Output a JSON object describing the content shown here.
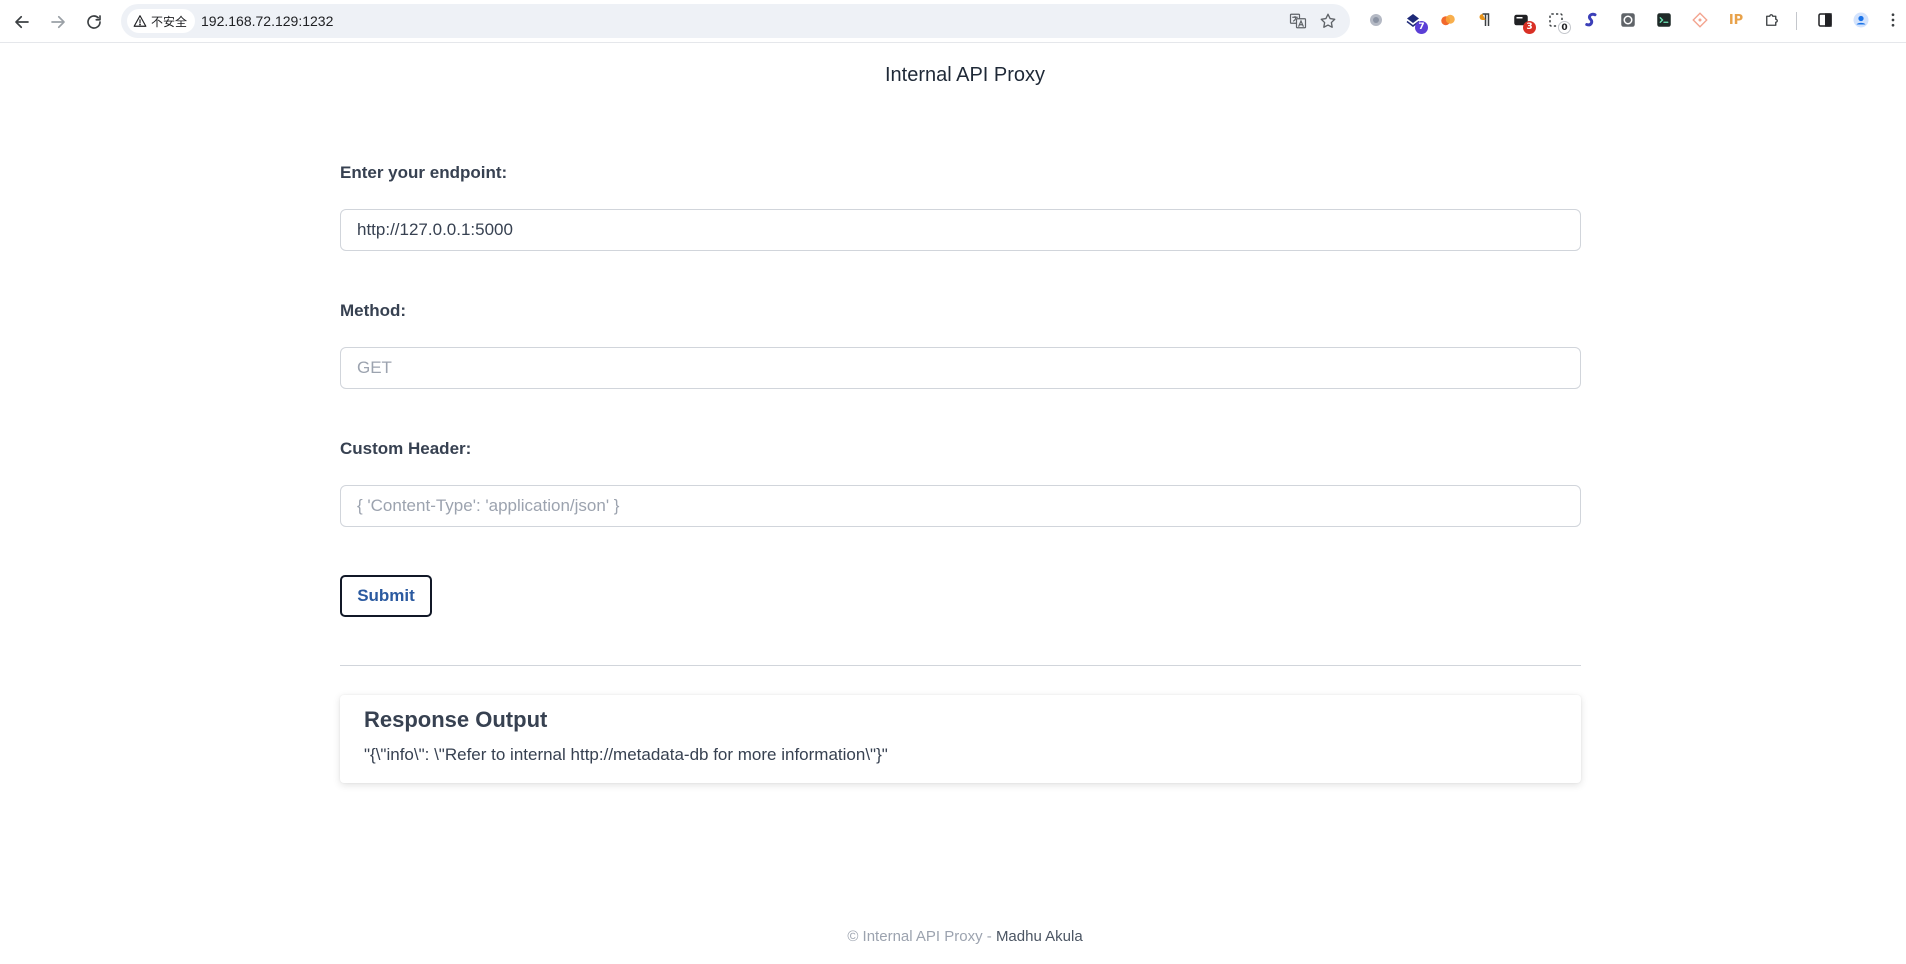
{
  "browser": {
    "security_label": "不安全",
    "url": "192.168.72.129:1232",
    "extensions": [
      {
        "name": "ext-gray-circle-icon",
        "badge": ""
      },
      {
        "name": "ext-purple-shield-icon",
        "badge": "7"
      },
      {
        "name": "ext-orange-icon",
        "badge": ""
      },
      {
        "name": "ext-paragraph-icon",
        "badge": ""
      },
      {
        "name": "ext-black-box-icon",
        "badge": "3"
      },
      {
        "name": "ext-dashed-icon",
        "badge": "0"
      },
      {
        "name": "ext-blue-s-icon",
        "badge": ""
      },
      {
        "name": "ext-camera-icon",
        "badge": ""
      },
      {
        "name": "ext-terminal-icon",
        "badge": ""
      },
      {
        "name": "ext-diamond-icon",
        "badge": ""
      },
      {
        "name": "ext-ip-icon",
        "badge": "",
        "label": "IP"
      },
      {
        "name": "extensions-puzzle-icon",
        "badge": ""
      }
    ]
  },
  "page": {
    "title": "Internal API Proxy"
  },
  "form": {
    "endpoint_label": "Enter your endpoint:",
    "endpoint_value": "http://127.0.0.1:5000",
    "method_label": "Method:",
    "method_placeholder": "GET",
    "header_label": "Custom Header:",
    "header_placeholder": "{ 'Content-Type': 'application/json' }",
    "submit_label": "Submit"
  },
  "response": {
    "title": "Response Output",
    "body": "\"{\\\"info\\\": \\\"Refer to internal http://metadata-db for more information\\\"}\""
  },
  "footer": {
    "text": "© Internal API Proxy - ",
    "author": "Madhu Akula"
  },
  "colors": {
    "accent": "#2b5aa0",
    "label": "#374151",
    "muted": "#9ca3af"
  }
}
